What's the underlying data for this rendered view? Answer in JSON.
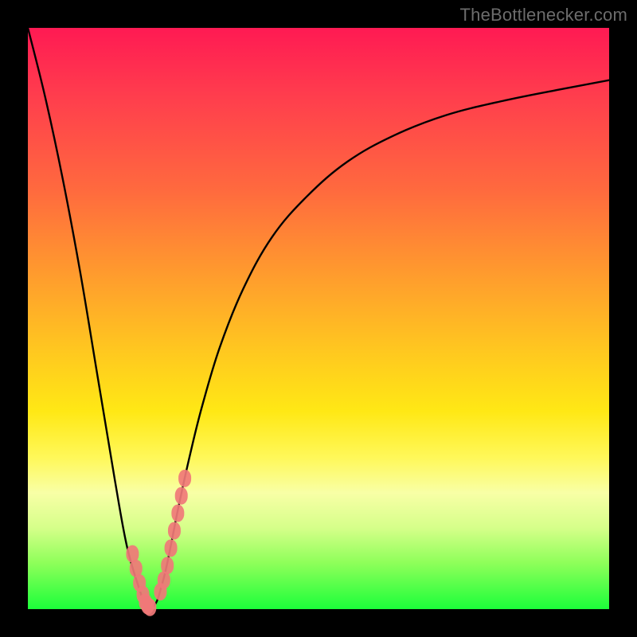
{
  "watermark": "TheBottlenecker.com",
  "chart_data": {
    "type": "line",
    "title": "",
    "xlabel": "",
    "ylabel": "",
    "xlim": [
      0,
      100
    ],
    "ylim": [
      0,
      100
    ],
    "series": [
      {
        "name": "bottleneck-curve",
        "x": [
          0,
          3,
          6,
          9,
          12,
          15,
          17,
          19,
          20.5,
          22,
          23,
          24,
          26,
          28,
          30,
          33,
          37,
          42,
          48,
          55,
          63,
          72,
          82,
          92,
          100
        ],
        "y": [
          100,
          88,
          74,
          58,
          40,
          22,
          11,
          4,
          0.3,
          1,
          4,
          8,
          18,
          27,
          35,
          45,
          55,
          64,
          71,
          77,
          81.5,
          85,
          87.5,
          89.5,
          91
        ]
      }
    ],
    "markers": {
      "name": "data-points",
      "x": [
        18.0,
        18.6,
        19.2,
        19.8,
        20.2,
        20.6,
        21.0,
        22.8,
        23.4,
        24.0,
        24.6,
        25.2,
        25.8,
        26.4,
        27.0
      ],
      "y": [
        9.5,
        7.0,
        4.5,
        2.5,
        1.2,
        0.6,
        0.3,
        3.0,
        5.0,
        7.5,
        10.5,
        13.5,
        16.5,
        19.5,
        22.5
      ]
    }
  },
  "colors": {
    "curve": "#000000",
    "marker_fill": "#f07878",
    "marker_stroke": "#f07878"
  }
}
